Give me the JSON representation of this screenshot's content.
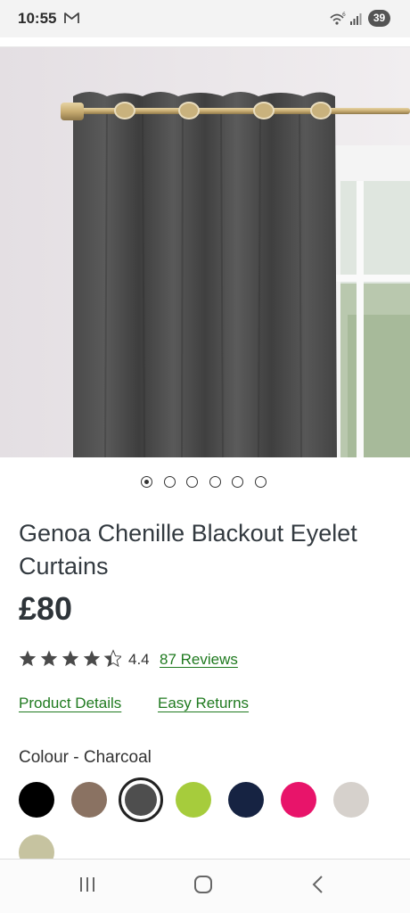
{
  "status_bar": {
    "time": "10:55",
    "battery": "39",
    "mail_icon": "gmail-icon",
    "wifi_icon": "wifi-icon",
    "signal_icon": "signal-icon"
  },
  "product": {
    "title": "Genoa Chenille Blackout Eyelet Curtains",
    "price": "£80",
    "rating": {
      "value": "4.4",
      "stars": 4.4,
      "max_stars": 5,
      "reviews_label": "87 Reviews"
    },
    "links": {
      "details": "Product Details",
      "returns": "Easy Returns"
    },
    "gallery": {
      "count": 6,
      "active_index": 0
    },
    "colour": {
      "label": "Colour - Charcoal",
      "swatches": [
        {
          "name": "Black",
          "hex": "#000000"
        },
        {
          "name": "Mink",
          "hex": "#8a7262"
        },
        {
          "name": "Charcoal",
          "hex": "#4e4e4e",
          "selected": true
        },
        {
          "name": "Lime",
          "hex": "#a6cc3c"
        },
        {
          "name": "Navy",
          "hex": "#162342"
        },
        {
          "name": "Pink",
          "hex": "#e8146a"
        },
        {
          "name": "Grey",
          "hex": "#d6d1cc"
        },
        {
          "name": "Sage",
          "hex": "#c6c3a0"
        }
      ]
    }
  },
  "nav": {
    "recents_icon": "recents-icon",
    "home_icon": "home-icon",
    "back_icon": "back-icon"
  },
  "colors": {
    "link_green": "#1f7a1f",
    "text": "#333a40"
  }
}
